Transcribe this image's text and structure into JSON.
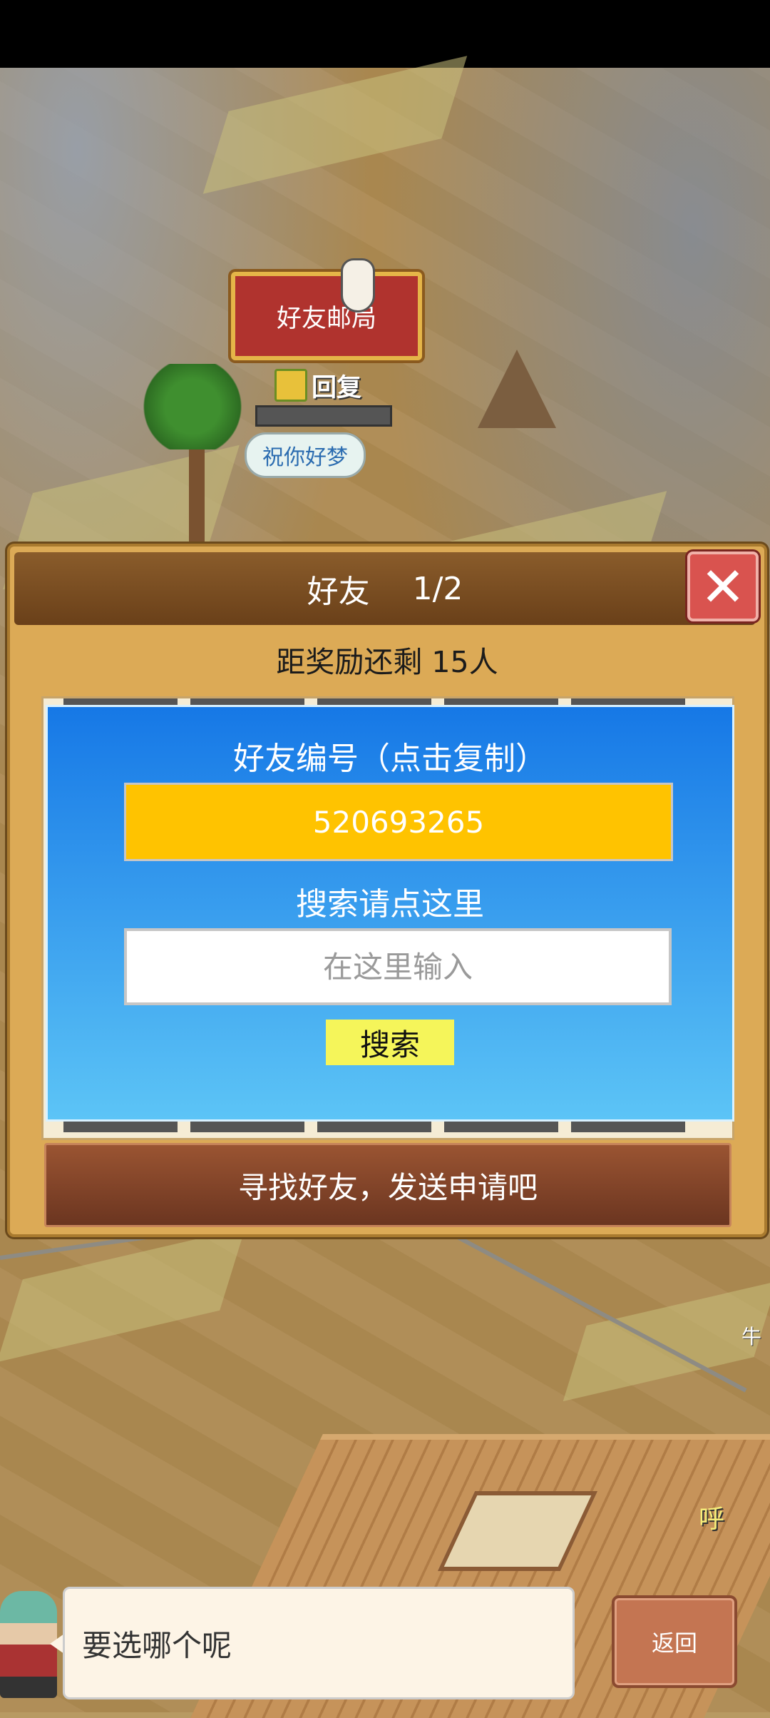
{
  "map": {
    "post_office_label": "好友邮局",
    "reply_label": "回复",
    "dream_bubble": "祝你好梦",
    "hu_label": "呼",
    "right_edge_glyph": "牛"
  },
  "dialog": {
    "title": "好友",
    "page": "1/2",
    "close_icon": "close-icon",
    "reward_text": "距奖励还剩 15人",
    "friend_id_title": "好友编号（点击复制）",
    "friend_id": "520693265",
    "search_title": "搜索请点这里",
    "search_placeholder": "在这里输入",
    "search_button": "搜索",
    "find_button": "寻找好友，发送申请吧"
  },
  "bottom": {
    "speech": "要选哪个呢",
    "back_button": "返回"
  },
  "colors": {
    "dialog_bg": "#dcaa56",
    "id_box": "#ffc300",
    "search_button": "#f5f55a",
    "close_button": "#d9534f",
    "find_button": "#7a3d25"
  }
}
